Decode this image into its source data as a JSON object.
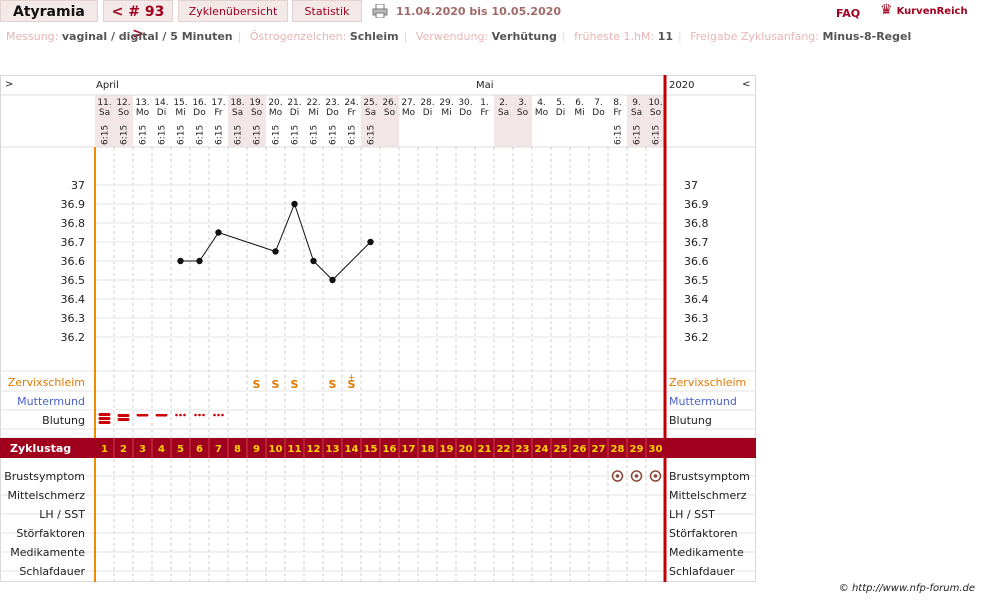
{
  "header": {
    "brand": "Atyramia",
    "cycle_label": "< # 93 >",
    "tab_overview": "Zyklenübersicht",
    "tab_stats": "Statistik",
    "date_range": "11.04.2020 bis 10.05.2020",
    "faq": "FAQ",
    "logo": "KurvenReich"
  },
  "meta": [
    {
      "key": "Messung:",
      "value": "vaginal / digital / 5 Minuten"
    },
    {
      "key": "Östrogenzeichen:",
      "value": "Schleim"
    },
    {
      "key": "Verwendung:",
      "value": "Verhütung"
    },
    {
      "key": "früheste 1.hM:",
      "value": "11"
    },
    {
      "key": "Freigabe Zyklusanfang:",
      "value": "Minus-8-Regel"
    }
  ],
  "nav": {
    "prev": ">",
    "next": "<",
    "year": "2020"
  },
  "chart_data": {
    "type": "line",
    "months": [
      {
        "label": "April",
        "start_day": 1
      },
      {
        "label": "Mai",
        "start_day": 21
      }
    ],
    "days": [
      {
        "d": "11.",
        "w": "Sa"
      },
      {
        "d": "12.",
        "w": "So"
      },
      {
        "d": "13.",
        "w": "Mo"
      },
      {
        "d": "14.",
        "w": "Di"
      },
      {
        "d": "15.",
        "w": "Mi"
      },
      {
        "d": "16.",
        "w": "Do"
      },
      {
        "d": "17.",
        "w": "Fr"
      },
      {
        "d": "18.",
        "w": "Sa"
      },
      {
        "d": "19.",
        "w": "So"
      },
      {
        "d": "20.",
        "w": "Mo"
      },
      {
        "d": "21.",
        "w": "Di"
      },
      {
        "d": "22.",
        "w": "Mi"
      },
      {
        "d": "23.",
        "w": "Do"
      },
      {
        "d": "24.",
        "w": "Fr"
      },
      {
        "d": "25.",
        "w": "Sa"
      },
      {
        "d": "26.",
        "w": "So"
      },
      {
        "d": "27.",
        "w": "Mo"
      },
      {
        "d": "28.",
        "w": "Di"
      },
      {
        "d": "29.",
        "w": "Mi"
      },
      {
        "d": "30.",
        "w": "Do"
      },
      {
        "d": "1.",
        "w": "Fr"
      },
      {
        "d": "2.",
        "w": "Sa"
      },
      {
        "d": "3.",
        "w": "So"
      },
      {
        "d": "4.",
        "w": "Mo"
      },
      {
        "d": "5.",
        "w": "Di"
      },
      {
        "d": "6.",
        "w": "Mi"
      },
      {
        "d": "7.",
        "w": "Do"
      },
      {
        "d": "8.",
        "w": "Fr"
      },
      {
        "d": "9.",
        "w": "Sa"
      },
      {
        "d": "10.",
        "w": "So"
      }
    ],
    "time_days": [
      1,
      2,
      3,
      4,
      5,
      6,
      7,
      8,
      9,
      10,
      11,
      12,
      13,
      14,
      15,
      28,
      29,
      30
    ],
    "time_label": "6:15",
    "y_ticks": [
      "37",
      "36.9",
      "36.8",
      "36.7",
      "36.6",
      "36.5",
      "36.4",
      "36.3",
      "36.2"
    ],
    "ylim": [
      36.2,
      37.0
    ],
    "series": [
      {
        "x": [
          5,
          6,
          7,
          10,
          11,
          12,
          13,
          15
        ],
        "y": [
          36.6,
          36.6,
          36.75,
          36.65,
          36.9,
          36.6,
          36.5,
          36.7
        ]
      }
    ],
    "cervix_label": "Zervixschleim",
    "cervix": [
      {
        "day": 9,
        "mark": "S"
      },
      {
        "day": 10,
        "mark": "S"
      },
      {
        "day": 11,
        "mark": "S"
      },
      {
        "day": 13,
        "mark": "S"
      },
      {
        "day": 14,
        "mark": "S+"
      }
    ],
    "mm_label": "Muttermund",
    "bleed_label": "Blutung",
    "bleed": [
      {
        "day": 1,
        "level": "heavy"
      },
      {
        "day": 2,
        "level": "medium"
      },
      {
        "day": 3,
        "level": "light"
      },
      {
        "day": 4,
        "level": "light"
      },
      {
        "day": 5,
        "level": "spot"
      },
      {
        "day": 6,
        "level": "spot"
      },
      {
        "day": 7,
        "level": "spot"
      }
    ],
    "cycle_label": "Zyklustag",
    "cycle_days": [
      "1",
      "2",
      "3",
      "4",
      "5",
      "6",
      "7",
      "8",
      "9",
      "10",
      "11",
      "12",
      "13",
      "14",
      "15",
      "16",
      "17",
      "18",
      "19",
      "20",
      "21",
      "22",
      "23",
      "24",
      "25",
      "26",
      "27",
      "28",
      "29",
      "30"
    ],
    "lower_rows": [
      "Brustsymptom",
      "Mittelschmerz",
      "LH / SST",
      "Störfaktoren",
      "Medikamente",
      "Schlafdauer"
    ],
    "breast_days": [
      28,
      29,
      30
    ]
  },
  "footer": "© http://www.nfp-forum.de"
}
